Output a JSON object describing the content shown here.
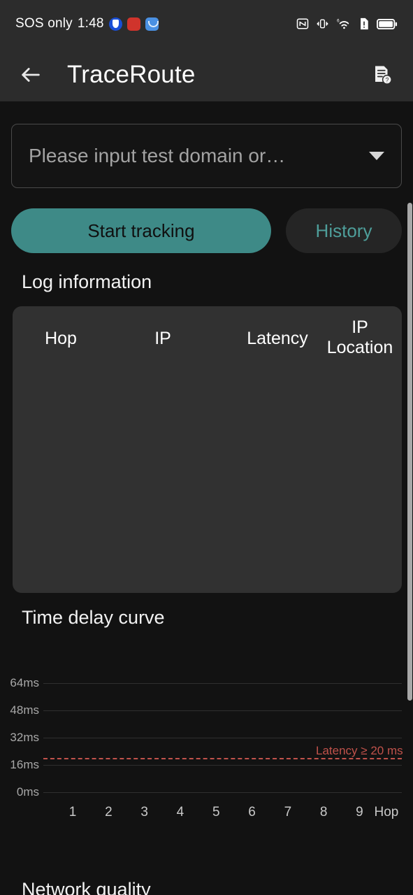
{
  "statusbar": {
    "carrier": "SOS only",
    "time": "1:48",
    "app_icons": [
      "shield-icon",
      "red-app-icon",
      "blue-app-icon"
    ],
    "right_icons": [
      "nfc-icon",
      "vibrate-icon",
      "wifi-6-icon",
      "sim-alert-icon",
      "battery-icon"
    ]
  },
  "appbar": {
    "title": "TraceRoute",
    "back_icon": "back-arrow-icon",
    "help_icon": "document-help-icon"
  },
  "form": {
    "domain_placeholder": "Please input test domain or…",
    "domain_value": "",
    "dropdown_icon": "chevron-down-icon",
    "start_button": "Start tracking",
    "history_button": "History"
  },
  "sections": {
    "log_title": "Log information",
    "chart_title": "Time delay curve",
    "network_title": "Network quality"
  },
  "log_table": {
    "columns": [
      "Hop",
      "IP",
      "Latency",
      "IP Location"
    ],
    "rows": []
  },
  "chart_data": {
    "type": "line",
    "title": "Time delay curve",
    "xlabel": "Hop",
    "ylabel": "",
    "x": [
      1,
      2,
      3,
      4,
      5,
      6,
      7,
      8,
      9
    ],
    "xtick_labels": [
      "1",
      "2",
      "3",
      "4",
      "5",
      "6",
      "7",
      "8",
      "9"
    ],
    "x_axis_name": "Hop",
    "ytick_labels": [
      "0ms",
      "16ms",
      "32ms",
      "48ms",
      "64ms"
    ],
    "ytick_values": [
      0,
      16,
      32,
      48,
      64
    ],
    "ylim": [
      0,
      72
    ],
    "series": [
      {
        "name": "Latency",
        "values": []
      }
    ],
    "grid": true,
    "legend": "none",
    "annotations": [
      {
        "text": "Latency ≥ 20 ms",
        "value": 20,
        "style": "dashed-threshold-line",
        "color": "#C0524B"
      }
    ]
  },
  "colors": {
    "accent": "#3E8A87",
    "background": "#121212",
    "appbar": "#2C2C2C",
    "panel": "#313131",
    "threshold": "#C0524B"
  },
  "scrollbar": {
    "name": "vertical-scrollbar"
  }
}
